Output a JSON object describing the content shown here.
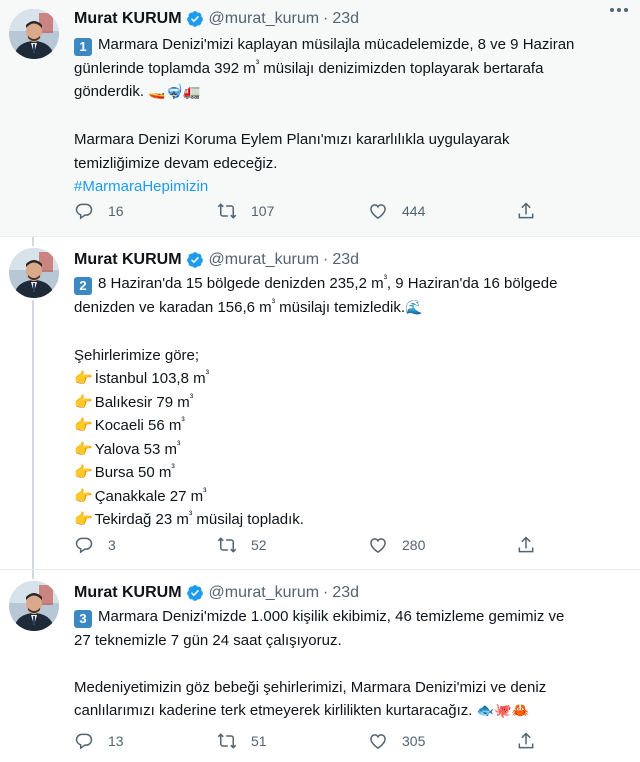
{
  "author": {
    "name": "Murat KURUM",
    "handle": "@murat_kurum",
    "separator": "·",
    "time": "23d"
  },
  "tweets": [
    {
      "number": "1",
      "lines": [
        "Marmara Denizi'mizi kaplayan müsilajla mücadelemizde, 8 ve 9 Haziran",
        "günlerinde toplamda 392 m",
        "³",
        " müsilajı denizimizden toplayarak bertarafa",
        "gönderdik.",
        "🚤🤿🚛",
        "Marmara Denizi Koruma Eylem Planı'mızı kararlılıkla uygulayarak",
        "temizliğimize devam edeceğiz.",
        "#MarmaraHepimizin"
      ],
      "replies": "16",
      "retweets": "107",
      "likes": "444"
    },
    {
      "number": "2",
      "lines": [
        "8 Haziran'da 15 bölgede denizden 235,2 m",
        "³",
        ", 9 Haziran'da 16 bölgede",
        "denizden ve karadan 156,6 m",
        "³",
        " müsilajı temizledik.",
        "🌊",
        "Şehirlerimize göre;"
      ],
      "cities": [
        {
          "text": "İstanbul 103,8 m",
          "sup": "³",
          "tail": ""
        },
        {
          "text": "Balıkesir 79 m",
          "sup": "³",
          "tail": ""
        },
        {
          "text": "Kocaeli 56 m",
          "sup": "³",
          "tail": ""
        },
        {
          "text": "Yalova 53 m",
          "sup": "³",
          "tail": ""
        },
        {
          "text": "Bursa 50 m",
          "sup": "³",
          "tail": ""
        },
        {
          "text": "Çanakkale 27 m",
          "sup": "³",
          "tail": ""
        },
        {
          "text": "Tekirdağ 23 m",
          "sup": "³",
          "tail": " müsilaj topladık."
        }
      ],
      "point_glyph": "👉",
      "replies": "3",
      "retweets": "52",
      "likes": "280"
    },
    {
      "number": "3",
      "lines": [
        "Marmara Denizi'mizde 1.000 kişilik ekibimiz, 46 temizleme gemimiz ve",
        "27 teknemizle 7 gün 24 saat çalışıyoruz.",
        "Medeniyetimizin göz bebeği şehirlerimizi, Marmara Denizi'mizi ve deniz",
        "canlılarımızı kaderine terk etmeyerek kirlilikten kurtaracağız.",
        "🐟🐙🦀"
      ],
      "replies": "13",
      "retweets": "51",
      "likes": "305"
    }
  ],
  "icons": {
    "reply": "reply-icon",
    "retweet": "retweet-icon",
    "like": "heart-icon",
    "share": "share-icon",
    "verified": "verified-badge-icon",
    "more": "more-options-icon"
  },
  "colors": {
    "verified": "#1d9bf0",
    "hashtag": "#1d9bf0",
    "secondary_text": "#536471",
    "badge": "#3b88c3"
  }
}
